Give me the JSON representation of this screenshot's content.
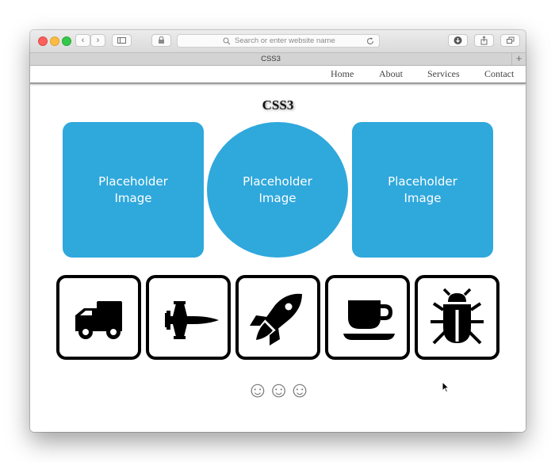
{
  "browser": {
    "url_placeholder": "Search or enter website name",
    "tab_title": "CSS3",
    "new_tab_symbol": "+",
    "back_symbol": "‹",
    "forward_symbol": "›"
  },
  "nav": {
    "links": [
      "Home",
      "About",
      "Services",
      "Contact"
    ]
  },
  "page": {
    "title": "CSS3",
    "placeholders": [
      "Placeholder Image",
      "Placeholder Image",
      "Placeholder Image"
    ],
    "icons": [
      "truck-icon",
      "fighter-jet-icon",
      "rocket-icon",
      "coffee-cup-icon",
      "bug-icon"
    ],
    "smileys": "☺☺☺"
  },
  "colors": {
    "placeholder_blue": "#2fa8dc",
    "icon_border": "#000000",
    "smiley_gray": "#7a7a7a"
  }
}
